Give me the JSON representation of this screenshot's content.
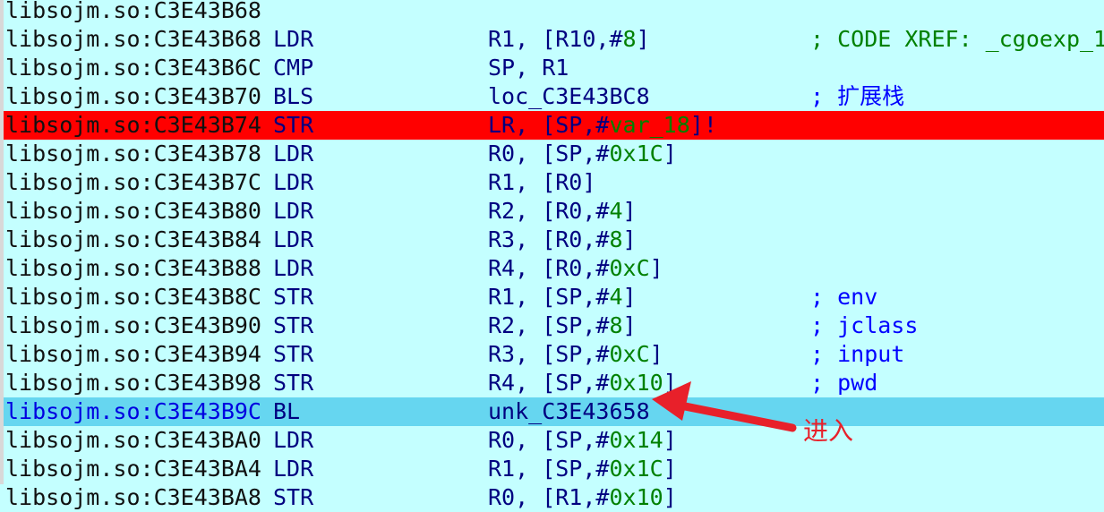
{
  "rows": [
    {
      "addr": "libsojm.so:C3E43B68",
      "mn": "",
      "op": [],
      "cm": ""
    },
    {
      "addr": "libsojm.so:C3E43B68",
      "mn": "LDR",
      "op": [
        [
          "R1, [R10,#",
          false
        ],
        [
          "8",
          true
        ],
        [
          "]",
          false
        ]
      ],
      "cm": "; CODE XREF: _cgoexp_1",
      "xref": true
    },
    {
      "addr": "libsojm.so:C3E43B6C",
      "mn": "CMP",
      "op": [
        [
          "SP, R1",
          false
        ]
      ],
      "cm": ""
    },
    {
      "addr": "libsojm.so:C3E43B70",
      "mn": "BLS",
      "op": [
        [
          "loc_C3E43BC8",
          false
        ]
      ],
      "cm": "; 扩展栈"
    },
    {
      "addr": "libsojm.so:C3E43B74",
      "mn": "STR",
      "op": [
        [
          "LR, [SP,#",
          false
        ],
        [
          "var_18",
          true
        ],
        [
          "]!",
          false
        ]
      ],
      "cm": "",
      "state": "breakpoint"
    },
    {
      "addr": "libsojm.so:C3E43B78",
      "mn": "LDR",
      "op": [
        [
          "R0, [SP,#",
          false
        ],
        [
          "0x1C",
          true
        ],
        [
          "]",
          false
        ]
      ],
      "cm": ""
    },
    {
      "addr": "libsojm.so:C3E43B7C",
      "mn": "LDR",
      "op": [
        [
          "R1, [R0]",
          false
        ]
      ],
      "cm": ""
    },
    {
      "addr": "libsojm.so:C3E43B80",
      "mn": "LDR",
      "op": [
        [
          "R2, [R0,#",
          false
        ],
        [
          "4",
          true
        ],
        [
          "]",
          false
        ]
      ],
      "cm": ""
    },
    {
      "addr": "libsojm.so:C3E43B84",
      "mn": "LDR",
      "op": [
        [
          "R3, [R0,#",
          false
        ],
        [
          "8",
          true
        ],
        [
          "]",
          false
        ]
      ],
      "cm": ""
    },
    {
      "addr": "libsojm.so:C3E43B88",
      "mn": "LDR",
      "op": [
        [
          "R4, [R0,#",
          false
        ],
        [
          "0xC",
          true
        ],
        [
          "]",
          false
        ]
      ],
      "cm": ""
    },
    {
      "addr": "libsojm.so:C3E43B8C",
      "mn": "STR",
      "op": [
        [
          "R1, [SP,#",
          false
        ],
        [
          "4",
          true
        ],
        [
          "]",
          false
        ]
      ],
      "cm": "; env"
    },
    {
      "addr": "libsojm.so:C3E43B90",
      "mn": "STR",
      "op": [
        [
          "R2, [SP,#",
          false
        ],
        [
          "8",
          true
        ],
        [
          "]",
          false
        ]
      ],
      "cm": "; jclass"
    },
    {
      "addr": "libsojm.so:C3E43B94",
      "mn": "STR",
      "op": [
        [
          "R3, [SP,#",
          false
        ],
        [
          "0xC",
          true
        ],
        [
          "]",
          false
        ]
      ],
      "cm": "; input"
    },
    {
      "addr": "libsojm.so:C3E43B98",
      "mn": "STR",
      "op": [
        [
          "R4, [SP,#",
          false
        ],
        [
          "0x10",
          true
        ],
        [
          "]",
          false
        ]
      ],
      "cm": "; pwd"
    },
    {
      "addr": "libsojm.so:C3E43B9C",
      "mn": "BL",
      "op": [
        [
          "unk_C3E43658",
          false
        ]
      ],
      "cm": "",
      "state": "selected"
    },
    {
      "addr": "libsojm.so:C3E43BA0",
      "mn": "LDR",
      "op": [
        [
          "R0, [SP,#",
          false
        ],
        [
          "0x14",
          true
        ],
        [
          "]",
          false
        ]
      ],
      "cm": ""
    },
    {
      "addr": "libsojm.so:C3E43BA4",
      "mn": "LDR",
      "op": [
        [
          "R1, [SP,#",
          false
        ],
        [
          "0x1C",
          true
        ],
        [
          "]",
          false
        ]
      ],
      "cm": ""
    },
    {
      "addr": "libsojm.so:C3E43BA8",
      "mn": "STR",
      "op": [
        [
          "R0, [R1,#",
          false
        ],
        [
          "0x10",
          true
        ],
        [
          "]",
          false
        ]
      ],
      "cm": ""
    }
  ],
  "annotation": {
    "text": "进入",
    "color": "#e8202a"
  },
  "colors": {
    "background": "#c4ffff",
    "breakpoint": "#ff0000",
    "selected": "#66d6f0"
  }
}
